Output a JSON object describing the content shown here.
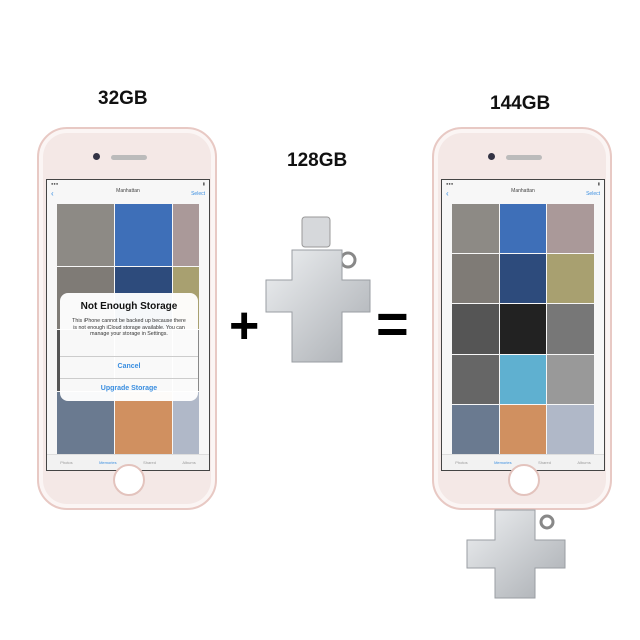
{
  "labels": {
    "left": "32GB",
    "middle": "128GB",
    "right": "144GB"
  },
  "operators": {
    "plus": "+",
    "equals": "="
  },
  "screen": {
    "title": "Manhattan",
    "action": "Select",
    "back": "‹",
    "tabs": [
      "Photos",
      "Memories",
      "Shared",
      "Albums"
    ]
  },
  "alert": {
    "title": "Not Enough Storage",
    "message": "This iPhone cannot be backed up because there is not enough iCloud storage available. You can manage your storage in Settings.",
    "cancel": "Cancel",
    "upgrade": "Upgrade Storage"
  },
  "colors": {
    "phone_body": "#f4e8e6",
    "link": "#3a8ee0",
    "drive": "#c9ccd0"
  }
}
